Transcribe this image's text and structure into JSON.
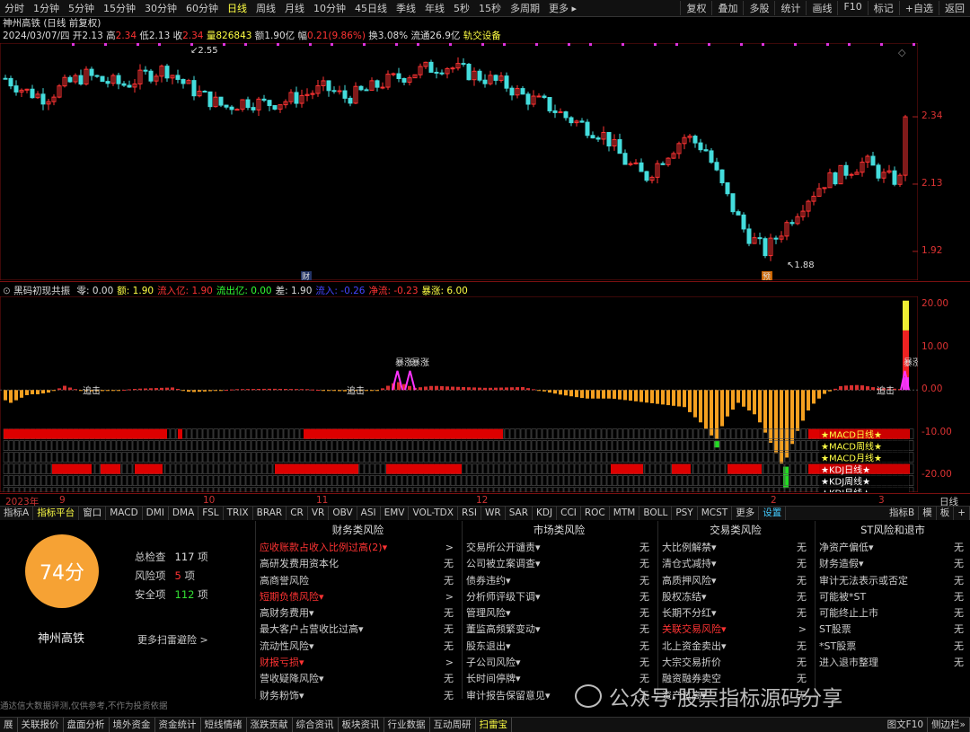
{
  "toolbar": {
    "periods": [
      "分时",
      "1分钟",
      "5分钟",
      "15分钟",
      "30分钟",
      "60分钟",
      "日线",
      "周线",
      "月线",
      "10分钟",
      "45日线",
      "季线",
      "年线",
      "5秒",
      "15秒",
      "多周期",
      "更多 ▸"
    ],
    "active_period": "日线",
    "right_buttons": [
      "复权",
      "叠加",
      "多股",
      "统计",
      "画线",
      "F10",
      "标记",
      "+自选",
      "返回"
    ]
  },
  "stock": {
    "title": "神州高铁 (日线 前复权)",
    "date": "2024/03/07/四",
    "open_label": "开",
    "open": "2.13",
    "high_label": "高",
    "high": "2.34",
    "low_label": "低",
    "low": "2.13",
    "close_label": "收",
    "close": "2.34",
    "vol_label": "量",
    "vol": "826843",
    "amount_label": "额",
    "amount": "1.90亿",
    "change_label": "幅",
    "change": "0.21(9.86%)",
    "turnover_label": "换",
    "turnover": "3.08%",
    "float_label": "流通",
    "float": "26.9亿",
    "signal": "轨交设备"
  },
  "k_chart": {
    "y_labels": [
      "2.34",
      "2.13",
      "1.92"
    ],
    "price_range": [
      1.83,
      2.57
    ],
    "high_marker": "2.55",
    "low_marker": "1.88",
    "badges": [
      "财",
      "预"
    ]
  },
  "indicator": {
    "name": "黑码初现共振",
    "items": [
      {
        "label": "零: ",
        "value": "0.00",
        "color": "#ddd"
      },
      {
        "label": "额: ",
        "value": "1.90",
        "color": "#ff4"
      },
      {
        "label": "流入亿: ",
        "value": "1.90",
        "color": "#f33"
      },
      {
        "label": "流出亿: ",
        "value": "0.00",
        "color": "#3f3"
      },
      {
        "label": "差: ",
        "value": "1.90",
        "color": "#ddd"
      },
      {
        "label": "流入: ",
        "value": "-0.26",
        "color": "#44f"
      },
      {
        "label": "净流: ",
        "value": "-0.23",
        "color": "#f33"
      },
      {
        "label": "暴涨: ",
        "value": "6.00",
        "color": "#ff4"
      }
    ],
    "y_labels": [
      "20.00",
      "10.00",
      "0.00",
      "-10.00",
      "-20.00"
    ],
    "value_range": [
      -24,
      22
    ],
    "annotations": [
      "追击",
      "追击",
      "暴涨",
      "暴涨",
      "追击",
      "暴涨"
    ],
    "rows": [
      "★MACD日线★",
      "★MACD周线★",
      "★MACD月线★",
      "★KDJ日线★",
      "★KDJ周线★",
      "★KDJ月线★"
    ]
  },
  "x_axis": {
    "labels": [
      "2023年",
      "9",
      "10",
      "11",
      "12",
      "2",
      "3"
    ],
    "right": "日线"
  },
  "tabs": {
    "items": [
      "指标A",
      "指标平台",
      "窗口",
      "MACD",
      "DMI",
      "DMA",
      "FSL",
      "TRIX",
      "BRAR",
      "CR",
      "VR",
      "OBV",
      "ASI",
      "EMV",
      "VOL-TDX",
      "RSI",
      "WR",
      "SAR",
      "KDJ",
      "CCI",
      "ROC",
      "MTM",
      "BOLL",
      "PSY",
      "MCST",
      "更多",
      "设置"
    ],
    "active": "指标平台",
    "right": [
      "指标B",
      "模",
      "板",
      "+"
    ]
  },
  "scan": {
    "score": "74分",
    "stock_name": "神州高铁",
    "stats": [
      {
        "label": "总检查",
        "value": "117",
        "unit": "项"
      },
      {
        "label": "风险项",
        "value": "5",
        "unit": "项"
      },
      {
        "label": "安全项",
        "value": "112",
        "unit": "项"
      }
    ],
    "more": "更多扫雷避险 >",
    "disclaimer": "通达信大数据评测,仅供参考,不作为投资依据",
    "columns": [
      {
        "header": "财务类风险",
        "rows": [
          {
            "label": "应收账款占收入比例过高(2)▾",
            "value": ">",
            "risk": true
          },
          {
            "label": "高研发费用资本化",
            "value": "无",
            "risk": false
          },
          {
            "label": "高商誉风险",
            "value": "无",
            "risk": false
          },
          {
            "label": "短期负债风险▾",
            "value": ">",
            "risk": true
          },
          {
            "label": "高财务费用▾",
            "value": "无",
            "risk": false
          },
          {
            "label": "最大客户占营收比过高▾",
            "value": "无",
            "risk": false
          },
          {
            "label": "流动性风险▾",
            "value": "无",
            "risk": false
          },
          {
            "label": "财报亏损▾",
            "value": ">",
            "risk": true
          },
          {
            "label": "营收疑降风险▾",
            "value": "无",
            "risk": false
          },
          {
            "label": "财务粉饰▾",
            "value": "无",
            "risk": false
          }
        ]
      },
      {
        "header": "市场类风险",
        "rows": [
          {
            "label": "交易所公开谴责▾",
            "value": "无",
            "risk": false
          },
          {
            "label": "公司被立案调查▾",
            "value": "无",
            "risk": false
          },
          {
            "label": "债券违约▾",
            "value": "无",
            "risk": false
          },
          {
            "label": "分析师评级下调▾",
            "value": "无",
            "risk": false
          },
          {
            "label": "管理风险▾",
            "value": "无",
            "risk": false
          },
          {
            "label": "董监高频繁变动▾",
            "value": "无",
            "risk": false
          },
          {
            "label": "股东退出▾",
            "value": "无",
            "risk": false
          },
          {
            "label": "子公司风险▾",
            "value": "无",
            "risk": false
          },
          {
            "label": "长时间停牌▾",
            "value": "无",
            "risk": false
          },
          {
            "label": "审计报告保留意见▾",
            "value": "无",
            "risk": false
          }
        ]
      },
      {
        "header": "交易类风险",
        "rows": [
          {
            "label": "大比例解禁▾",
            "value": "无",
            "risk": false
          },
          {
            "label": "清仓式减持▾",
            "value": "无",
            "risk": false
          },
          {
            "label": "高质押风险▾",
            "value": "无",
            "risk": false
          },
          {
            "label": "股权冻结▾",
            "value": "无",
            "risk": false
          },
          {
            "label": "长期不分红▾",
            "value": "无",
            "risk": false
          },
          {
            "label": "关联交易风险▾",
            "value": ">",
            "risk": true
          },
          {
            "label": "北上资金卖出▾",
            "value": "无",
            "risk": false
          },
          {
            "label": "大宗交易折价",
            "value": "无",
            "risk": false
          },
          {
            "label": "融资融券卖空",
            "value": "无",
            "risk": false
          },
          {
            "label": "资产过高▾",
            "value": "无",
            "risk": false
          }
        ]
      },
      {
        "header": "ST风险和退市",
        "rows": [
          {
            "label": "净资产偏低▾",
            "value": "无",
            "risk": false
          },
          {
            "label": "财务造假▾",
            "value": "无",
            "risk": false
          },
          {
            "label": "审计无法表示或否定",
            "value": "无",
            "risk": false
          },
          {
            "label": "可能被*ST",
            "value": "无",
            "risk": false
          },
          {
            "label": "可能终止上市",
            "value": "无",
            "risk": false
          },
          {
            "label": "ST股票",
            "value": "无",
            "risk": false
          },
          {
            "label": "*ST股票",
            "value": "无",
            "risk": false
          },
          {
            "label": "进入退市整理",
            "value": "无",
            "risk": false
          }
        ]
      }
    ]
  },
  "status_bar": {
    "items": [
      "展",
      "关联报价",
      "盘面分析",
      "境外资金",
      "资金统计",
      "短线情绪",
      "涨跌贡献",
      "综合资讯",
      "板块资讯",
      "行业数据",
      "互动周研",
      "扫雷宝"
    ],
    "active": "扫雷宝",
    "right": [
      "图文F10",
      "侧边栏»"
    ]
  },
  "watermark": "公众号·股票指标源码分享"
}
